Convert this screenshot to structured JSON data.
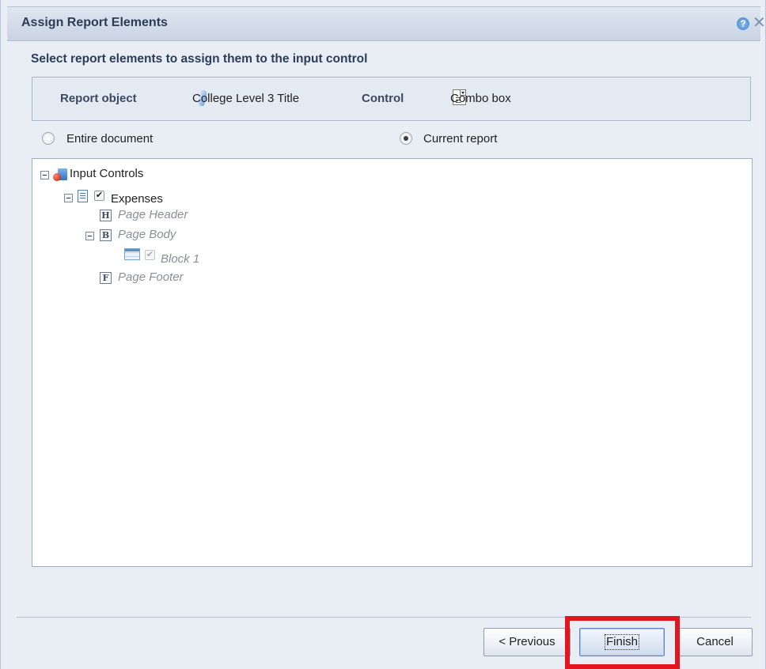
{
  "dialog": {
    "title": "Assign Report Elements",
    "help_icon": "help-icon",
    "close_icon": "close-icon",
    "instruction": "Select report elements to assign them to the input control"
  },
  "info": {
    "report_object_label": "Report object",
    "report_object_value": "College Level 3 Title",
    "control_label": "Control",
    "control_value": "Combo box"
  },
  "scope": {
    "entire_document": "Entire document",
    "current_report": "Current report",
    "selected": "current_report"
  },
  "tree": {
    "root": "Input Controls",
    "report": "Expenses",
    "page_header": "Page Header",
    "page_body": "Page Body",
    "block": "Block 1",
    "page_footer": "Page Footer",
    "header_letter": "H",
    "body_letter": "B",
    "footer_letter": "F"
  },
  "buttons": {
    "previous": "< Previous",
    "finish": "Finish",
    "cancel": "Cancel"
  },
  "colors": {
    "highlight": "#e3161f",
    "title_text": "#2b3d58"
  }
}
